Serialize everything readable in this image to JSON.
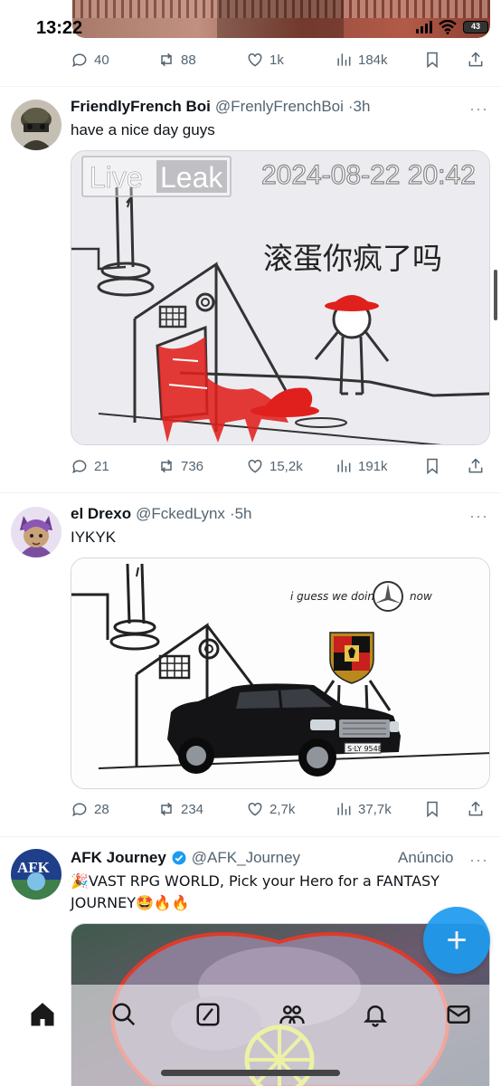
{
  "status": {
    "time": "13:22",
    "battery": "43"
  },
  "top_actions": {
    "replies": "40",
    "retweets": "88",
    "likes": "1k",
    "views": "184k"
  },
  "tweets": [
    {
      "name": "FriendlyFrench Boi",
      "handle": "@FrenlyFrenchBoi",
      "time": "·3h",
      "text": "have a nice day guys",
      "media": {
        "watermark_a": "Live",
        "watermark_b": "Leak",
        "timestamp": "2024-08-22 20:42",
        "caption": "滚蛋你疯了吗"
      },
      "replies": "21",
      "retweets": "736",
      "likes": "15,2k",
      "views": "191k"
    },
    {
      "name": "el Drexo",
      "handle": "@FckedLynx",
      "time": "·5h",
      "text": "IYKYK",
      "media": {
        "caption_a": "i guess we doin",
        "caption_b": "now",
        "plate": "S·LY 9548"
      },
      "replies": "28",
      "retweets": "234",
      "likes": "2,7k",
      "views": "37,7k"
    },
    {
      "name": "AFK Journey",
      "handle": "@AFK_Journey",
      "ad_label": "Anúncio",
      "text": "🎉VAST RPG WORLD, Pick your Hero for a FANTASY JOURNEY🤩🔥🔥",
      "avatar_text": "AFK"
    }
  ],
  "more_label": "···",
  "fab_label": "+",
  "colors": {
    "accent": "#1d9bf0",
    "text_primary": "#0f1419",
    "text_secondary": "#536471",
    "blood": "#e0201c"
  }
}
